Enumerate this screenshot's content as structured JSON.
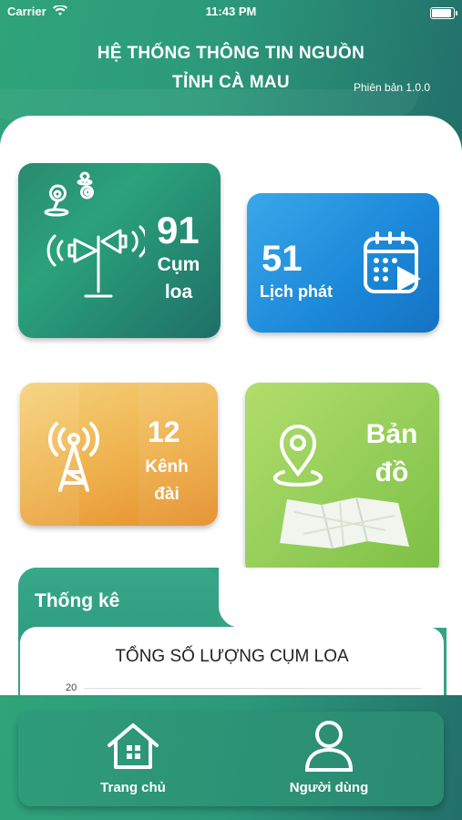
{
  "status_bar": {
    "carrier": "Carrier",
    "time": "11:43 PM"
  },
  "header": {
    "title_line1": "HỆ THỐNG THÔNG TIN NGUỒN",
    "title_line2": "TỈNH CÀ MAU",
    "version": "Phiên bản 1.0.0"
  },
  "tiles": {
    "cum_loa": {
      "count": "91",
      "label_line1": "Cụm",
      "label_line2": "loa",
      "icon": "loudspeaker-pole-icon"
    },
    "lich_phat": {
      "count": "51",
      "label": "Lịch phát",
      "icon": "calendar-play-icon"
    },
    "kenh_dai": {
      "count": "12",
      "label_line1": "Kênh",
      "label_line2": "đài",
      "icon": "radio-tower-icon"
    },
    "ban_do": {
      "label_line1": "Bản",
      "label_line2": "đồ",
      "icon": "map-pin-icon"
    }
  },
  "stats": {
    "tab_title": "Thống kê",
    "chart_title": "TỔNG SỐ LƯỢNG CỤM LOA",
    "y_tick": "20"
  },
  "bottom_nav": {
    "home_label": "Trang chủ",
    "user_label": "Người dùng"
  },
  "colors": {
    "primary": "#2fa37a",
    "blue": "#1b87d8",
    "orange": "#eeb04b",
    "green": "#96cf5a"
  }
}
